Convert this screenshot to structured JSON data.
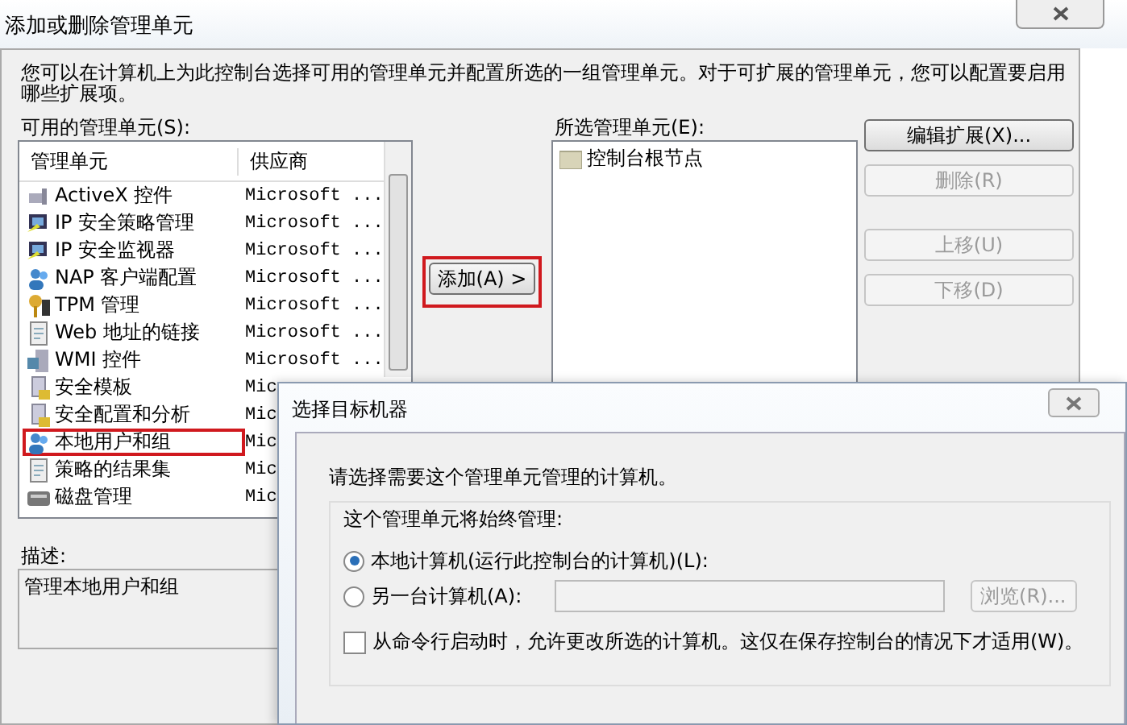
{
  "window": {
    "title": "添加或删除管理单元"
  },
  "intro": "您可以在计算机上为此控制台选择可用的管理单元并配置所选的一组管理单元。对于可扩展的管理单元，您可以配置要启用哪些扩展项。",
  "available": {
    "label": "可用的管理单元(S):",
    "columns": [
      "管理单元",
      "供应商"
    ],
    "rows": [
      {
        "name": "ActiveX 控件",
        "vendor": "Microsoft ...",
        "kind": "plug",
        "highlighted": false
      },
      {
        "name": "IP 安全策略管理",
        "vendor": "Microsoft ...",
        "kind": "monitor",
        "highlighted": false
      },
      {
        "name": "IP 安全监视器",
        "vendor": "Microsoft ...",
        "kind": "monitor",
        "highlighted": false
      },
      {
        "name": "NAP 客户端配置",
        "vendor": "Microsoft ...",
        "kind": "users",
        "highlighted": false
      },
      {
        "name": "TPM 管理",
        "vendor": "Microsoft ...",
        "kind": "key",
        "highlighted": false
      },
      {
        "name": "Web 地址的链接",
        "vendor": "Microsoft ...",
        "kind": "page",
        "highlighted": false
      },
      {
        "name": "WMI 控件",
        "vendor": "Microsoft ...",
        "kind": "server",
        "highlighted": false
      },
      {
        "name": "安全模板",
        "vendor": "Mic",
        "kind": "lock",
        "highlighted": false
      },
      {
        "name": "安全配置和分析",
        "vendor": "Mic",
        "kind": "lock",
        "highlighted": false
      },
      {
        "name": "本地用户和组",
        "vendor": "Mic",
        "kind": "users",
        "highlighted": true
      },
      {
        "name": "策略的结果集",
        "vendor": "Mic",
        "kind": "page",
        "highlighted": false
      },
      {
        "name": "磁盘管理",
        "vendor": "Mic",
        "kind": "disk",
        "highlighted": false
      }
    ]
  },
  "add_button": {
    "label": "添加(A) >",
    "highlighted": true
  },
  "selected_snapins": {
    "label": "所选管理单元(E):",
    "items": [
      "控制台根节点"
    ]
  },
  "side_buttons": [
    {
      "label": "编辑扩展(X)...",
      "disabled": false
    },
    {
      "label": "删除(R)",
      "disabled": true
    },
    {
      "label": "上移(U)",
      "disabled": true
    },
    {
      "label": "下移(D)",
      "disabled": true
    }
  ],
  "description": {
    "label": "描述:",
    "text": "管理本地用户和组"
  },
  "target_dialog": {
    "title": "选择目标机器",
    "prompt": "请选择需要这个管理单元管理的计算机。",
    "group_label": "这个管理单元将始终管理:",
    "options": [
      {
        "label": "本地计算机(运行此控制台的计算机)(L):",
        "selected": true
      },
      {
        "label": "另一台计算机(A):",
        "selected": false
      }
    ],
    "browse_button": {
      "label": "浏览(R)...",
      "disabled": true
    },
    "checkbox": {
      "label": "从命令行启动时，允许更改所选的计算机。这仅在保存控制台的情况下才适用(W)。",
      "checked": false
    }
  }
}
